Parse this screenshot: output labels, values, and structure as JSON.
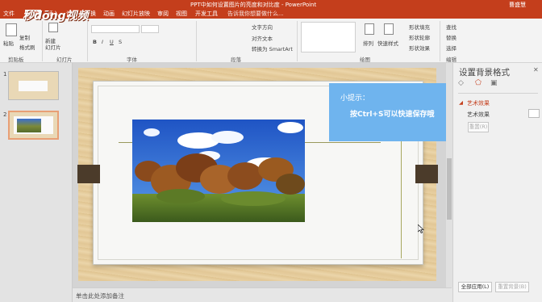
{
  "window": {
    "title": "PPT中如何设置图片的亮度和对比度 - PowerPoint",
    "user": "曹盛慧"
  },
  "watermark": "秒dōng视频",
  "tabs": [
    "文件",
    "开始",
    "插入",
    "设计",
    "切换",
    "动画",
    "幻灯片放映",
    "审阅",
    "视图",
    "开发工具",
    "告诉我你想要做什么..."
  ],
  "ribbon": {
    "paste": "粘贴",
    "copy": "复制",
    "format_painter": "格式刷",
    "new_slide": "新建\n幻灯片",
    "group_clipboard": "剪贴板",
    "group_slides": "幻灯片",
    "group_font": "字体",
    "group_paragraph": "段落",
    "group_drawing": "绘图",
    "group_editing": "编辑",
    "text_direction": "文字方向",
    "align_text": "对齐文本",
    "convert_smartart": "转换为 SmartArt",
    "arrange": "排列",
    "quick_styles": "快速样式",
    "shape_fill": "形状填充",
    "shape_outline": "形状轮廓",
    "shape_effects": "形状效果",
    "find": "查找",
    "replace": "替换",
    "select": "选择"
  },
  "slides_pane": {
    "numbers": [
      "1",
      "2"
    ]
  },
  "tooltip": {
    "line1": "小提示：",
    "line2": "按Ctrl+S可以快速保存哦"
  },
  "notes_placeholder": "单击此处添加备注",
  "format_pane": {
    "title": "设置背景格式",
    "section": "艺术效果",
    "field_label": "艺术效果",
    "reset_button": "重置(R)",
    "apply_all": "全部应用(L)",
    "reset_background": "重置背景(B)"
  },
  "colors": {
    "accent": "#c43e1c",
    "tooltip": "#6fb4ee",
    "wood": "#e4c995",
    "frame_clip": "#4b3b2a"
  }
}
